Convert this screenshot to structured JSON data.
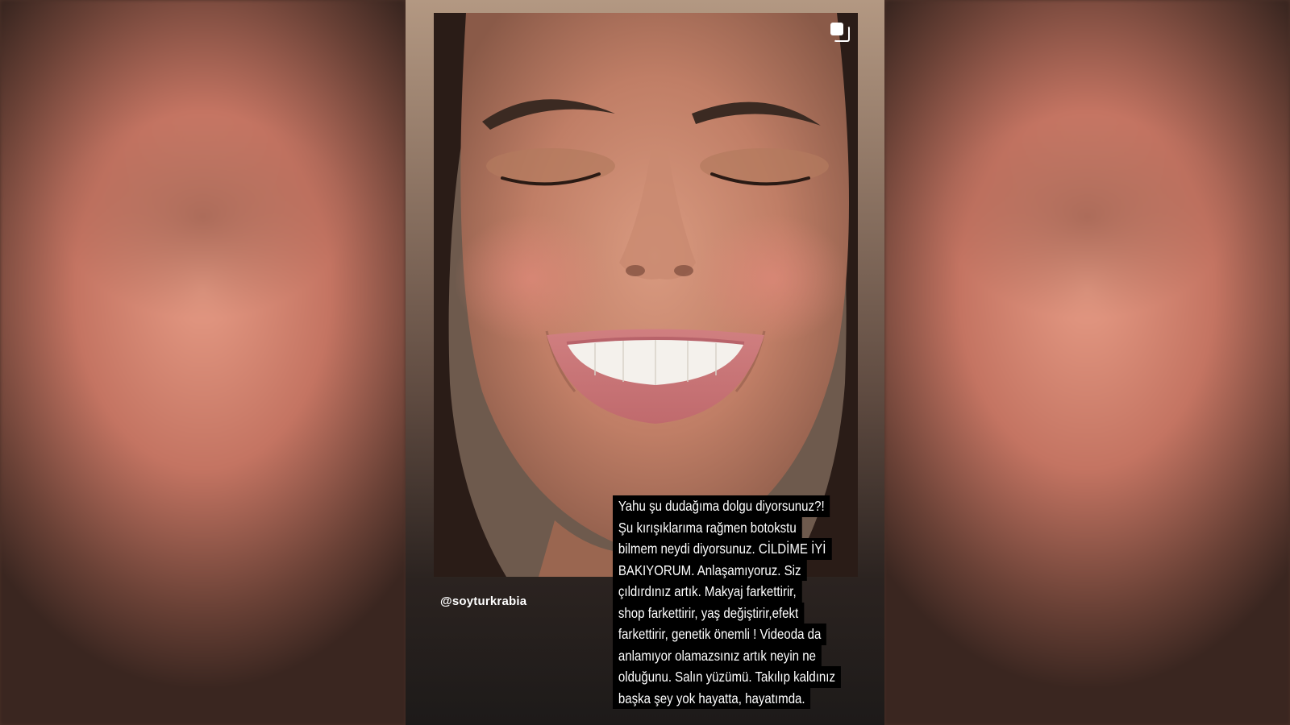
{
  "story": {
    "handle": "@soyturkrabia",
    "icons": {
      "multi_post": "multiple-posts-icon"
    },
    "caption_lines": [
      "Yahu şu dudağıma dolgu diyorsunuz?!",
      "Şu kırışıklarıma rağmen botokstu",
      "bilmem neydi diyorsunuz. CİLDİME İYİ",
      "BAKIYORUM. Anlaşamıyoruz. Siz",
      "çıldırdınız artık. Makyaj farkettirir,",
      "shop farkettirir, yaş değiştirir,efekt",
      "farkettirir, genetik önemli ! Videoda da",
      "anlamıyor olamazsınız artık neyin ne",
      "olduğunu. Salın yüzümü. Takılıp kaldınız",
      "başka şey yok hayatta, hayatımda."
    ]
  }
}
